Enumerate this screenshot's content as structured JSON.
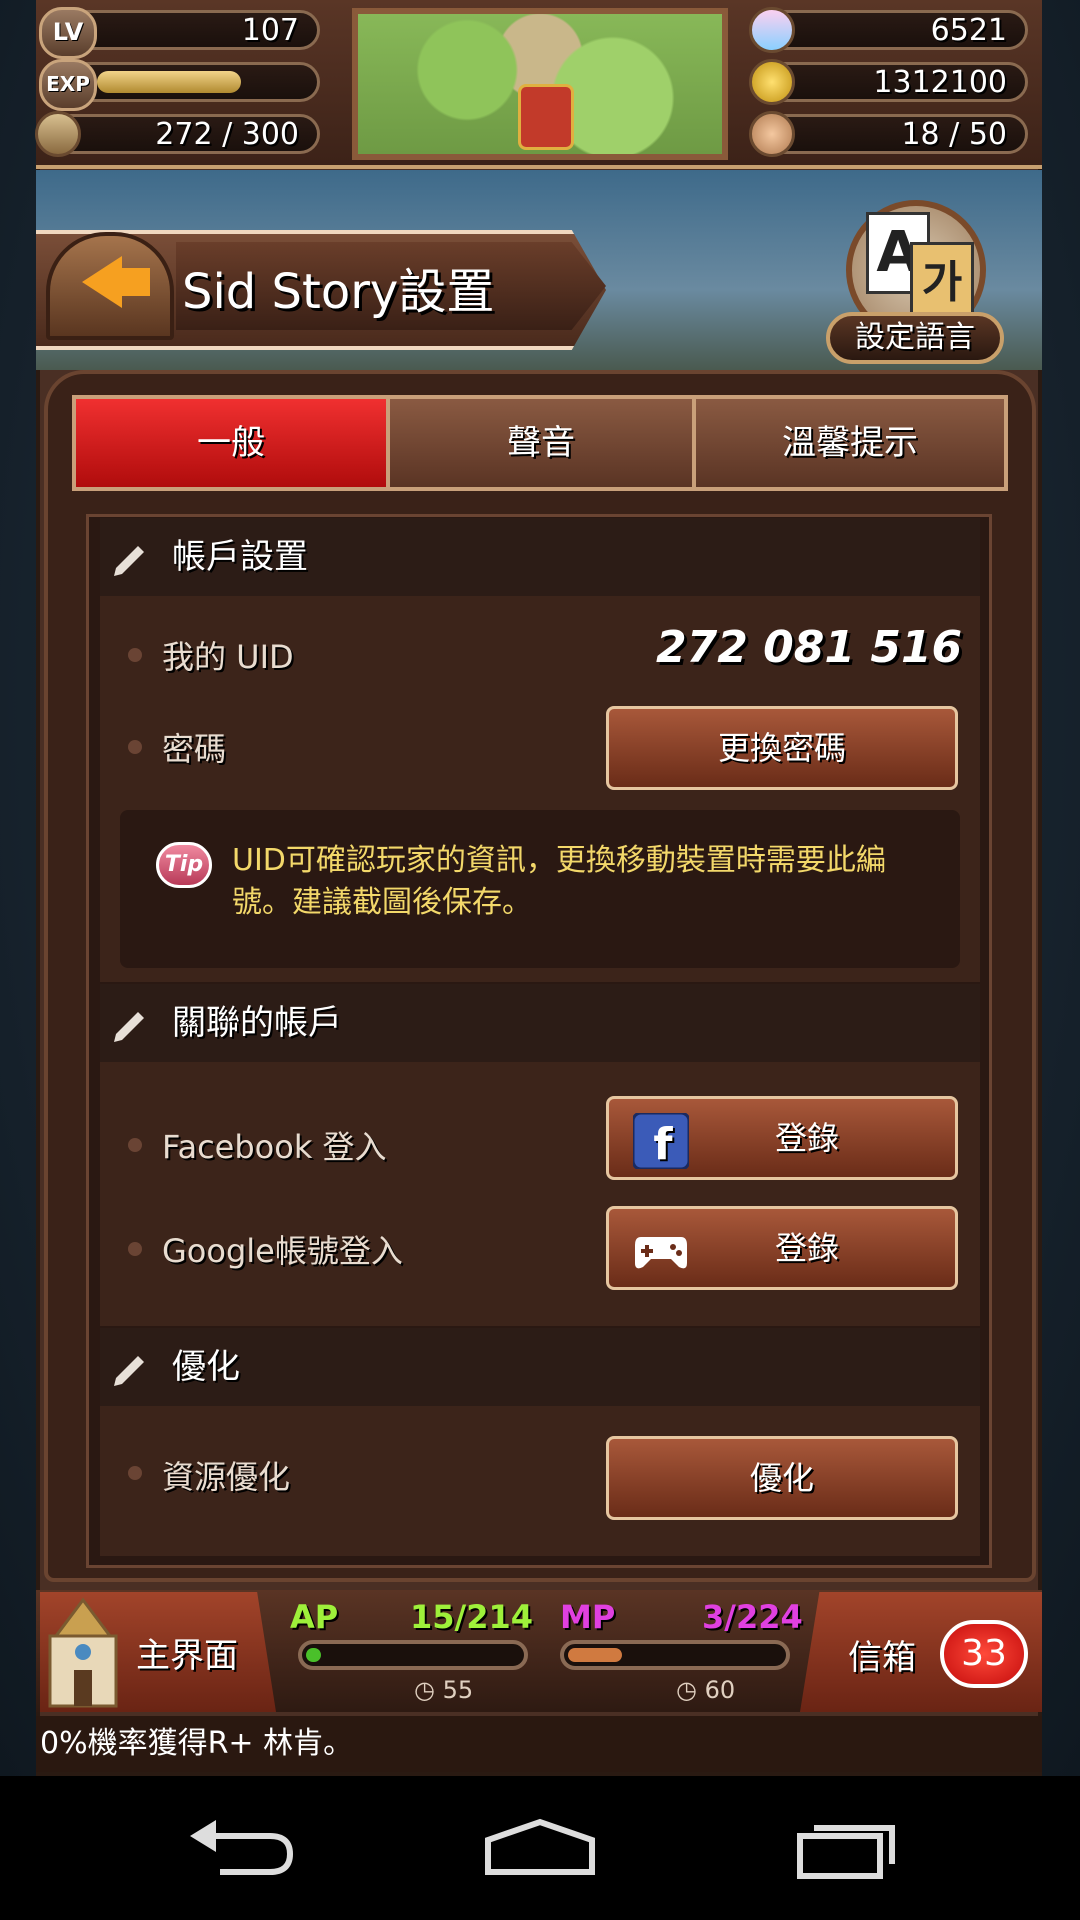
{
  "status": {
    "level_label": "LV",
    "level": "107",
    "exp_label": "EXP",
    "exp_progress": 0.72,
    "stamina": "272 / 300",
    "gems": "6521",
    "gold": "1312100",
    "friends": "18 / 50"
  },
  "header": {
    "title": "Sid Story設置",
    "language_button": "設定語言",
    "lang_glyph_a": "A",
    "lang_glyph_b": "가"
  },
  "tabs": [
    {
      "label": "一般",
      "active": true
    },
    {
      "label": "聲音",
      "active": false
    },
    {
      "label": "溫馨提示",
      "active": false
    }
  ],
  "account": {
    "section_title": "帳戶設置",
    "uid_label": "我的 UID",
    "uid_value": "272 081 516",
    "password_label": "密碼",
    "change_password_button": "更換密碼",
    "tip_badge": "Tip",
    "tip_text": "UID可確認玩家的資訊，更換移動裝置時需要此編號。建議截圖後保存。"
  },
  "linked": {
    "section_title": "關聯的帳戶",
    "facebook_label": "Facebook 登入",
    "facebook_button": "登錄",
    "google_label": "Google帳號登入",
    "google_button": "登錄"
  },
  "optimize": {
    "section_title": "優化",
    "resource_label": "資源優化",
    "optimize_button": "優化"
  },
  "bottom": {
    "home_label": "主界面",
    "ap_label": "AP",
    "ap_value": "15/214",
    "ap_timer": "55",
    "ap_progress": 0.07,
    "mp_label": "MP",
    "mp_value": "3/224",
    "mp_timer": "60",
    "mp_progress": 0.25,
    "mail_label": "信箱",
    "mail_count": "33",
    "ticker": "0%機率獲得R+ 林肯。"
  },
  "colors": {
    "ap": "#9ef03a",
    "mp": "#e040e0",
    "tab_active": "#e01c1c",
    "tip_text": "#f3d86a"
  }
}
